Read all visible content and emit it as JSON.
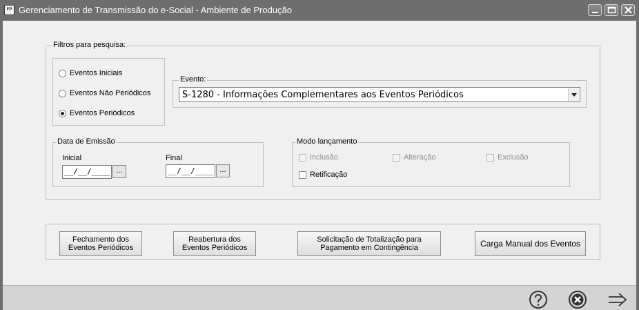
{
  "app": {
    "title": "Gerenciamento de Transmissão do e-Social - Ambiente de Produção",
    "icon_text": "FP"
  },
  "filters": {
    "legend": "Filtros para pesquisa:",
    "radios": [
      {
        "label": "Eventos Iniciais",
        "checked": false
      },
      {
        "label": "Eventos Não Periódicos",
        "checked": false
      },
      {
        "label": "Eventos Periódicos",
        "checked": true
      }
    ],
    "evento": {
      "legend": "Evento:",
      "selected": "S-1280 - Informações Complementares aos Eventos Periódicos"
    },
    "data_emissao": {
      "legend": "Data de Emissão",
      "inicial_label": "Inicial",
      "inicial_value": "__/__/____",
      "final_label": "Final",
      "final_value": "__/__/____",
      "picker_label": "..."
    },
    "modo": {
      "legend": "Modo lançamento",
      "inclusao": "Inclusão",
      "alteracao": "Alteração",
      "exclusao": "Exclusão",
      "retificacao": "Retificação"
    }
  },
  "actions": {
    "fechamento": "Fechamento dos Eventos Periódicos",
    "reabertura": "Reabertura dos Eventos Periódicos",
    "totalizacao": "Solicitação de Totalização para Pagamento em Contingência",
    "carga": "Carga Manual dos Eventos"
  },
  "footer_icons": [
    "help-icon",
    "close-circle-icon",
    "forward-arrow-icon"
  ],
  "colors": {
    "titlebar": "#6e6e6e",
    "window_bg": "#f0f0f0",
    "footer_bg": "#d4d4d4"
  }
}
